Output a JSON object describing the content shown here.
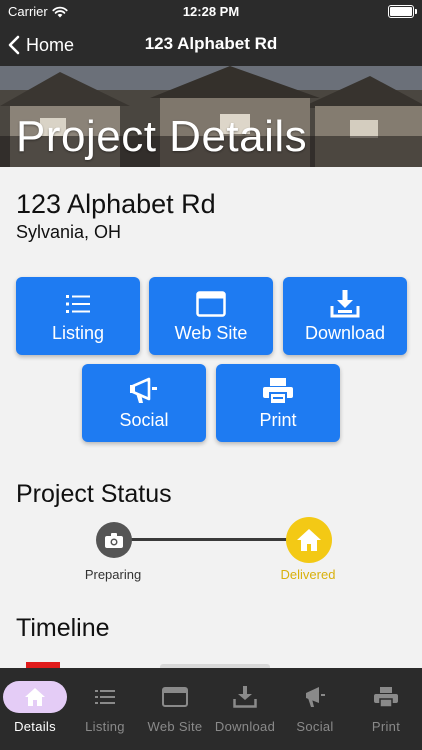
{
  "status_bar": {
    "carrier": "Carrier",
    "time": "12:28 PM"
  },
  "nav": {
    "back_label": "Home",
    "title": "123 Alphabet Rd"
  },
  "hero": {
    "title": "Project Details"
  },
  "project": {
    "address": "123 Alphabet Rd",
    "city": "Sylvania, OH"
  },
  "actions": [
    {
      "label": "Listing",
      "icon": "list-icon"
    },
    {
      "label": "Web Site",
      "icon": "browser-window-icon"
    },
    {
      "label": "Download",
      "icon": "download-tray-icon"
    },
    {
      "label": "Social",
      "icon": "megaphone-icon"
    },
    {
      "label": "Print",
      "icon": "printer-icon"
    }
  ],
  "status_section": {
    "title": "Project Status",
    "steps": [
      {
        "label": "Preparing",
        "icon": "camera-icon",
        "color": "#555555"
      },
      {
        "label": "Delivered",
        "icon": "home-icon",
        "color": "#f3c915"
      }
    ]
  },
  "timeline_section": {
    "title": "Timeline"
  },
  "tabs": [
    {
      "label": "Details",
      "icon": "home-icon",
      "active": true
    },
    {
      "label": "Listing",
      "icon": "list-icon"
    },
    {
      "label": "Web Site",
      "icon": "browser-window-icon"
    },
    {
      "label": "Download",
      "icon": "download-tray-icon"
    },
    {
      "label": "Social",
      "icon": "megaphone-icon"
    },
    {
      "label": "Print",
      "icon": "printer-icon"
    }
  ],
  "colors": {
    "bar_background": "#2b2b2b",
    "action_button": "#1e7bf2",
    "delivered": "#f3c915",
    "active_tab_pill": "#e4ccf6",
    "inactive_tab": "#8a8a8a"
  }
}
